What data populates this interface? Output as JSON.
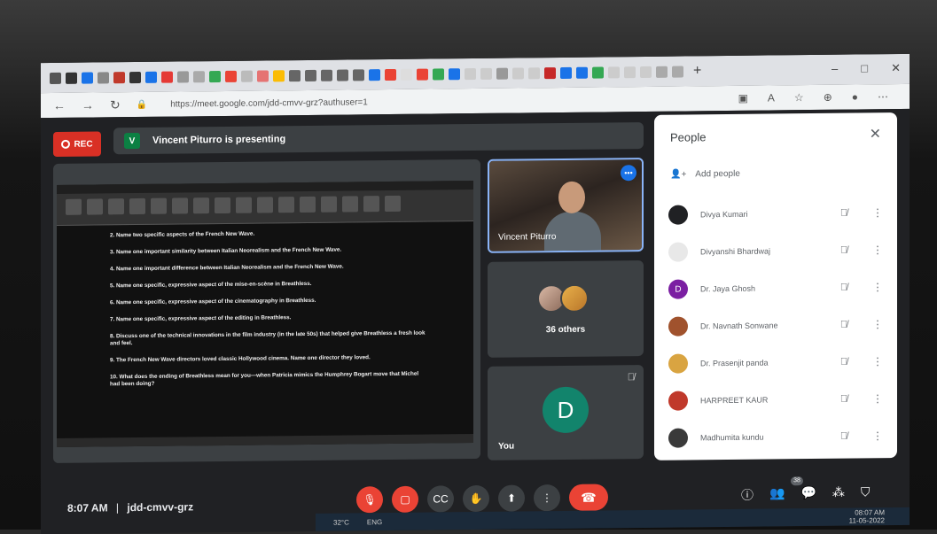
{
  "browser": {
    "url": "https://meet.google.com/jdd-cmvv-grz?authuser=1",
    "tabs_plus": "+",
    "win_min": "–",
    "win_max": "□",
    "win_close": "✕"
  },
  "meet": {
    "rec_label": "REC",
    "presenter_initial": "V",
    "presenting_text": "Vincent Piturro is presenting",
    "questions": [
      "2.  Name two specific aspects of the French New Wave.",
      "3.  Name one important similarity between Italian Neorealism and the French New Wave.",
      "4.  Name one important difference between Italian Neorealism and the French New Wave.",
      "5.  Name one specific, expressive aspect of the mise-en-scène in Breathless.",
      "6.  Name one specific, expressive aspect of the cinematography in Breathless.",
      "7.  Name one specific, expressive aspect of the editing in Breathless.",
      "8.  Discuss one of the technical innovations in the film industry (in the late 50s) that helped give Breathless a fresh look and feel.",
      "9.  The French New Wave directors loved classic Hollywood cinema. Name one director they loved.",
      "10. What does the ending of Breathless mean for you—when Patricia mimics the Humphrey Bogart move that Michel had been doing?"
    ],
    "video_name": "Vincent Piturro",
    "others_label": "36 others",
    "you_initial": "D",
    "you_label": "You",
    "time": "8:07 AM",
    "separator": "|",
    "meeting_code": "jdd-cmvv-grz",
    "participants_count": "38"
  },
  "people": {
    "title": "People",
    "add_label": "Add people",
    "list": [
      {
        "name": "Divya Kumari",
        "initial": "",
        "color": "#202124"
      },
      {
        "name": "Divyanshi Bhardwaj",
        "initial": "",
        "color": "#e8e8e8"
      },
      {
        "name": "Dr. Jaya Ghosh",
        "initial": "D",
        "color": "#7b1fa2"
      },
      {
        "name": "Dr. Navnath Sonwane",
        "initial": "",
        "color": "#a0522d"
      },
      {
        "name": "Dr. Prasenjit panda",
        "initial": "",
        "color": "#d9a441"
      },
      {
        "name": "HARPREET KAUR",
        "initial": "",
        "color": "#c0392b"
      },
      {
        "name": "Madhumita kundu",
        "initial": "",
        "color": "#3a3a3a"
      }
    ]
  },
  "taskbar": {
    "weather": "32°C",
    "lang": "ENG",
    "clock_time": "08:07 AM",
    "clock_date": "11-05-2022"
  }
}
